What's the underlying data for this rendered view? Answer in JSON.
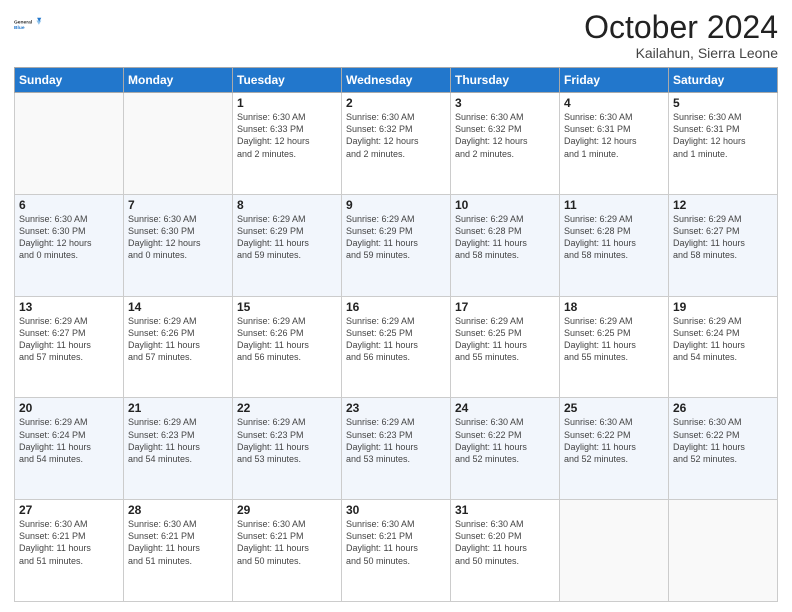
{
  "header": {
    "logo_line1": "General",
    "logo_line2": "Blue",
    "month_title": "October 2024",
    "subtitle": "Kailahun, Sierra Leone"
  },
  "days_of_week": [
    "Sunday",
    "Monday",
    "Tuesday",
    "Wednesday",
    "Thursday",
    "Friday",
    "Saturday"
  ],
  "weeks": [
    [
      {
        "day": "",
        "info": ""
      },
      {
        "day": "",
        "info": ""
      },
      {
        "day": "1",
        "info": "Sunrise: 6:30 AM\nSunset: 6:33 PM\nDaylight: 12 hours\nand 2 minutes."
      },
      {
        "day": "2",
        "info": "Sunrise: 6:30 AM\nSunset: 6:32 PM\nDaylight: 12 hours\nand 2 minutes."
      },
      {
        "day": "3",
        "info": "Sunrise: 6:30 AM\nSunset: 6:32 PM\nDaylight: 12 hours\nand 2 minutes."
      },
      {
        "day": "4",
        "info": "Sunrise: 6:30 AM\nSunset: 6:31 PM\nDaylight: 12 hours\nand 1 minute."
      },
      {
        "day": "5",
        "info": "Sunrise: 6:30 AM\nSunset: 6:31 PM\nDaylight: 12 hours\nand 1 minute."
      }
    ],
    [
      {
        "day": "6",
        "info": "Sunrise: 6:30 AM\nSunset: 6:30 PM\nDaylight: 12 hours\nand 0 minutes."
      },
      {
        "day": "7",
        "info": "Sunrise: 6:30 AM\nSunset: 6:30 PM\nDaylight: 12 hours\nand 0 minutes."
      },
      {
        "day": "8",
        "info": "Sunrise: 6:29 AM\nSunset: 6:29 PM\nDaylight: 11 hours\nand 59 minutes."
      },
      {
        "day": "9",
        "info": "Sunrise: 6:29 AM\nSunset: 6:29 PM\nDaylight: 11 hours\nand 59 minutes."
      },
      {
        "day": "10",
        "info": "Sunrise: 6:29 AM\nSunset: 6:28 PM\nDaylight: 11 hours\nand 58 minutes."
      },
      {
        "day": "11",
        "info": "Sunrise: 6:29 AM\nSunset: 6:28 PM\nDaylight: 11 hours\nand 58 minutes."
      },
      {
        "day": "12",
        "info": "Sunrise: 6:29 AM\nSunset: 6:27 PM\nDaylight: 11 hours\nand 58 minutes."
      }
    ],
    [
      {
        "day": "13",
        "info": "Sunrise: 6:29 AM\nSunset: 6:27 PM\nDaylight: 11 hours\nand 57 minutes."
      },
      {
        "day": "14",
        "info": "Sunrise: 6:29 AM\nSunset: 6:26 PM\nDaylight: 11 hours\nand 57 minutes."
      },
      {
        "day": "15",
        "info": "Sunrise: 6:29 AM\nSunset: 6:26 PM\nDaylight: 11 hours\nand 56 minutes."
      },
      {
        "day": "16",
        "info": "Sunrise: 6:29 AM\nSunset: 6:25 PM\nDaylight: 11 hours\nand 56 minutes."
      },
      {
        "day": "17",
        "info": "Sunrise: 6:29 AM\nSunset: 6:25 PM\nDaylight: 11 hours\nand 55 minutes."
      },
      {
        "day": "18",
        "info": "Sunrise: 6:29 AM\nSunset: 6:25 PM\nDaylight: 11 hours\nand 55 minutes."
      },
      {
        "day": "19",
        "info": "Sunrise: 6:29 AM\nSunset: 6:24 PM\nDaylight: 11 hours\nand 54 minutes."
      }
    ],
    [
      {
        "day": "20",
        "info": "Sunrise: 6:29 AM\nSunset: 6:24 PM\nDaylight: 11 hours\nand 54 minutes."
      },
      {
        "day": "21",
        "info": "Sunrise: 6:29 AM\nSunset: 6:23 PM\nDaylight: 11 hours\nand 54 minutes."
      },
      {
        "day": "22",
        "info": "Sunrise: 6:29 AM\nSunset: 6:23 PM\nDaylight: 11 hours\nand 53 minutes."
      },
      {
        "day": "23",
        "info": "Sunrise: 6:29 AM\nSunset: 6:23 PM\nDaylight: 11 hours\nand 53 minutes."
      },
      {
        "day": "24",
        "info": "Sunrise: 6:30 AM\nSunset: 6:22 PM\nDaylight: 11 hours\nand 52 minutes."
      },
      {
        "day": "25",
        "info": "Sunrise: 6:30 AM\nSunset: 6:22 PM\nDaylight: 11 hours\nand 52 minutes."
      },
      {
        "day": "26",
        "info": "Sunrise: 6:30 AM\nSunset: 6:22 PM\nDaylight: 11 hours\nand 52 minutes."
      }
    ],
    [
      {
        "day": "27",
        "info": "Sunrise: 6:30 AM\nSunset: 6:21 PM\nDaylight: 11 hours\nand 51 minutes."
      },
      {
        "day": "28",
        "info": "Sunrise: 6:30 AM\nSunset: 6:21 PM\nDaylight: 11 hours\nand 51 minutes."
      },
      {
        "day": "29",
        "info": "Sunrise: 6:30 AM\nSunset: 6:21 PM\nDaylight: 11 hours\nand 50 minutes."
      },
      {
        "day": "30",
        "info": "Sunrise: 6:30 AM\nSunset: 6:21 PM\nDaylight: 11 hours\nand 50 minutes."
      },
      {
        "day": "31",
        "info": "Sunrise: 6:30 AM\nSunset: 6:20 PM\nDaylight: 11 hours\nand 50 minutes."
      },
      {
        "day": "",
        "info": ""
      },
      {
        "day": "",
        "info": ""
      }
    ]
  ]
}
